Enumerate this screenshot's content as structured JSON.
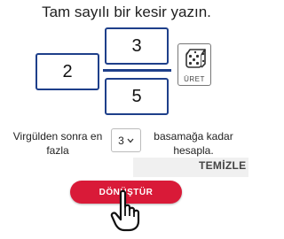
{
  "title": "Tam sayılı bir kesir yazın.",
  "fraction": {
    "whole": "2",
    "numerator": "3",
    "denominator": "5"
  },
  "dice_button": {
    "label": "ÜRET",
    "icon": "dice-icon"
  },
  "precision": {
    "left_text": "Virgülden sonra en fazla",
    "selected": "3",
    "right_text": "basamağa kadar hesapla."
  },
  "clear_label": "TEMİZLE",
  "convert_label": "DÖNÜŞTÜR",
  "colors": {
    "accent": "#1e3f8a",
    "button": "#d91a38"
  }
}
